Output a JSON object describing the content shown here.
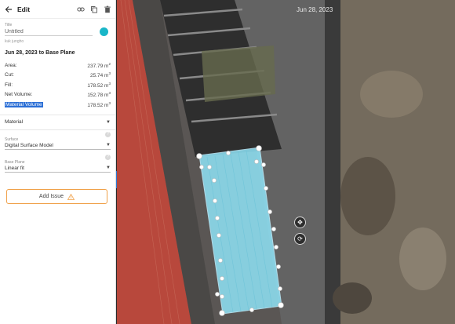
{
  "toolbar": {
    "title": "Edit",
    "icons": [
      "arrow-left-icon",
      "link-icon",
      "copy-icon",
      "trash-icon"
    ]
  },
  "form": {
    "title_label": "Title",
    "title_value": "Untitled",
    "author": "kuk jungho",
    "color": "#19b6c8"
  },
  "heading": "Jun 28, 2023 to Base Plane",
  "metrics": [
    {
      "label": "Area:",
      "value": "237.79 m",
      "unit_exp": "2"
    },
    {
      "label": "Cut:",
      "value": "25.74 m",
      "unit_exp": "3"
    },
    {
      "label": "Fill:",
      "value": "178.52 m",
      "unit_exp": "3"
    },
    {
      "label": "Net Volume:",
      "value": "152.78 m",
      "unit_exp": "3"
    },
    {
      "label": "Material Volume",
      "value": "178.52 m",
      "unit_exp": "3"
    }
  ],
  "material": {
    "label": "Material"
  },
  "surface": {
    "label": "Surface",
    "value": "Digital Surface Model"
  },
  "base_plane": {
    "label": "Base Plane",
    "value": "Linear fit"
  },
  "add_issue": {
    "label": "Add Issue"
  },
  "map": {
    "date": "Jun 28, 2023",
    "shape_color": "#8fe3f7"
  },
  "help_glyph": "?"
}
